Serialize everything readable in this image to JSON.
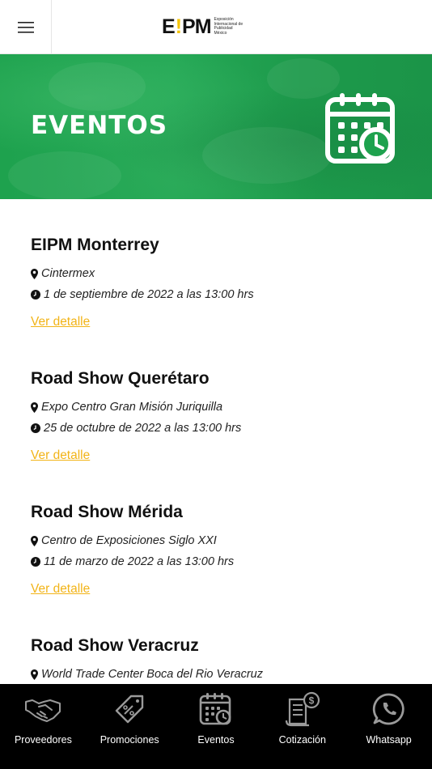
{
  "header": {
    "logo_mark_left": "E",
    "logo_mark_bang": "!",
    "logo_mark_right": "PM",
    "logo_sub": [
      "Exposición",
      "Internacional de",
      "Publicidad",
      "México"
    ]
  },
  "banner": {
    "title": "EVENTOS"
  },
  "events": [
    {
      "title": "EIPM Monterrey",
      "location": "Cintermex",
      "date": "1 de septiembre de 2022 a las 13:00 hrs",
      "link": "Ver detalle"
    },
    {
      "title": "Road Show Querétaro",
      "location": "Expo Centro Gran Misión Juriquilla",
      "date": "25 de octubre de 2022 a las 13:00 hrs",
      "link": "Ver detalle"
    },
    {
      "title": "Road Show Mérida",
      "location": "Centro de Exposiciones Siglo XXI",
      "date": "11 de marzo de 2022 a las 13:00 hrs",
      "link": "Ver detalle"
    },
    {
      "title": "Road Show Veracruz",
      "location": "World Trade Center Boca del Rio Veracruz",
      "date": "",
      "link": ""
    }
  ],
  "nav": [
    {
      "label": "Proveedores",
      "icon": "handshake-icon"
    },
    {
      "label": "Promociones",
      "icon": "discount-tag-icon"
    },
    {
      "label": "Eventos",
      "icon": "calendar-clock-icon"
    },
    {
      "label": "Cotización",
      "icon": "invoice-icon"
    },
    {
      "label": "Whatsapp",
      "icon": "whatsapp-icon"
    }
  ],
  "colors": {
    "banner_green": "#1ea24e",
    "link_yellow": "#f2b418",
    "nav_bg": "#000000"
  }
}
